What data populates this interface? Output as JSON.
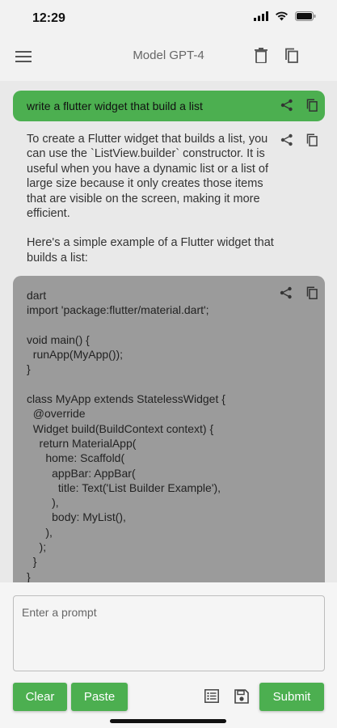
{
  "status_bar": {
    "time": "12:29"
  },
  "app_bar": {
    "title": "Model GPT-4"
  },
  "chat": {
    "prompt": "write a flutter widget that build a list",
    "answer_paragraphs": [
      "To create a Flutter widget that builds a list, you can use the `ListView.builder` constructor. It is useful when you have a dynamic list or a list of large size because it only creates those items that are visible on the screen, making it more efficient.",
      "Here's a simple example of a Flutter widget that builds a list:"
    ],
    "code": "dart\nimport 'package:flutter/material.dart';\n\nvoid main() {\n  runApp(MyApp());\n}\n\nclass MyApp extends StatelessWidget {\n  @override\n  Widget build(BuildContext context) {\n    return MaterialApp(\n      home: Scaffold(\n        appBar: AppBar(\n          title: Text('List Builder Example'),\n        ),\n        body: MyList(),\n      ),\n    );\n  }\n}"
  },
  "input": {
    "placeholder": "Enter a prompt"
  },
  "buttons": {
    "clear": "Clear",
    "paste": "Paste",
    "submit": "Submit"
  },
  "icons": {
    "menu": "menu-icon",
    "delete": "trash-icon",
    "copy": "copy-icon",
    "share": "share-icon",
    "list": "list-icon",
    "save": "save-icon"
  },
  "colors": {
    "accent": "#4caf50",
    "code_bg": "#9b9b9b",
    "chat_bg": "#e9e9e9"
  }
}
